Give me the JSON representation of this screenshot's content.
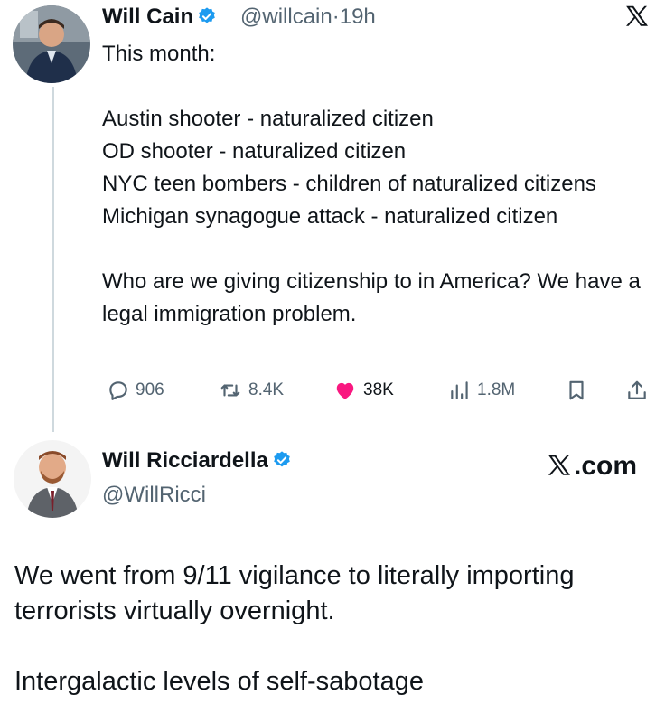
{
  "tweet": {
    "author_name": "Will Cain",
    "handle": "@willcain",
    "separator": "·",
    "time": "19h",
    "lines": [
      "This month:",
      "",
      "Austin shooter - naturalized citizen",
      "OD shooter - naturalized citizen",
      "NYC teen bombers - children of naturalized citizens",
      "Michigan synagogue attack - naturalized citizen",
      "",
      "Who are we giving citizenship to in America? We have a legal immigration problem."
    ],
    "actions": {
      "replies": "906",
      "reposts": "8.4K",
      "likes": "38K",
      "views": "1.8M"
    },
    "liked": true,
    "like_color": "#f91880",
    "verified_color": "#1d9bf0"
  },
  "reply": {
    "author_name": "Will Ricciardella",
    "handle": "@WillRicci",
    "source_label": ".com",
    "paragraphs": [
      "We went from 9/11 vigilance to literally importing terrorists virtually overnight.",
      "Intergalactic levels of self-sabotage"
    ]
  }
}
